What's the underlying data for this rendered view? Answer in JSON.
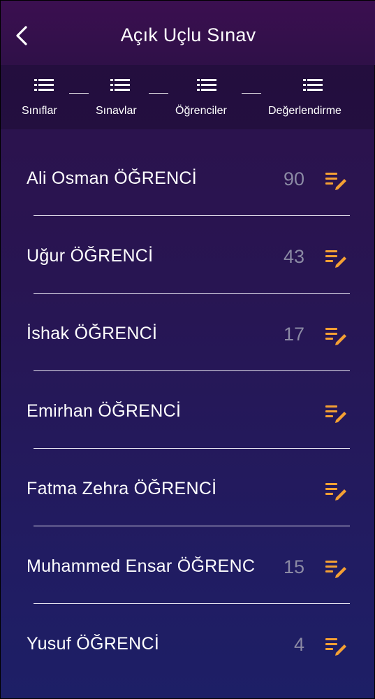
{
  "header": {
    "title": "Açık Uçlu Sınav"
  },
  "tabs": [
    {
      "label": "Sınıflar"
    },
    {
      "label": "Sınavlar"
    },
    {
      "label": "Öğrenciler"
    },
    {
      "label": "Değerlendirme"
    }
  ],
  "students": [
    {
      "name": "Ali Osman ÖĞRENCİ",
      "score": "90"
    },
    {
      "name": "Uğur ÖĞRENCİ",
      "score": "43"
    },
    {
      "name": "İshak ÖĞRENCİ",
      "score": "17"
    },
    {
      "name": "Emirhan ÖĞRENCİ",
      "score": ""
    },
    {
      "name": "Fatma Zehra ÖĞRENCİ",
      "score": ""
    },
    {
      "name": "Muhammed Ensar ÖĞRENC",
      "score": "15"
    },
    {
      "name": "Yusuf ÖĞRENCİ",
      "score": "4"
    }
  ],
  "colors": {
    "accent": "#f5a033",
    "score": "#8b8aa4"
  },
  "icons": {
    "back": "chevron-left-icon",
    "tab": "list-icon",
    "edit": "edit-list-icon"
  }
}
